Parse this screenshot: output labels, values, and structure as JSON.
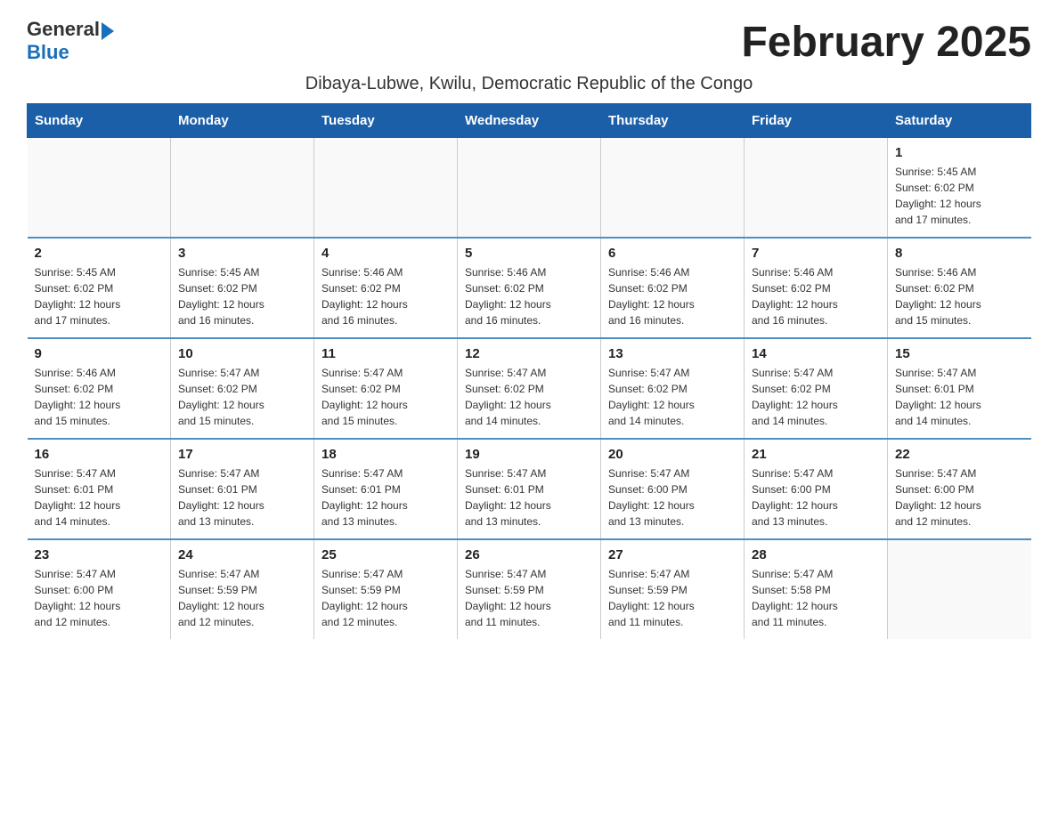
{
  "header": {
    "logo_general": "General",
    "logo_blue": "Blue",
    "month_title": "February 2025",
    "location": "Dibaya-Lubwe, Kwilu, Democratic Republic of the Congo"
  },
  "days_of_week": [
    "Sunday",
    "Monday",
    "Tuesday",
    "Wednesday",
    "Thursday",
    "Friday",
    "Saturday"
  ],
  "weeks": [
    {
      "days": [
        {
          "number": "",
          "info": "",
          "empty": true
        },
        {
          "number": "",
          "info": "",
          "empty": true
        },
        {
          "number": "",
          "info": "",
          "empty": true
        },
        {
          "number": "",
          "info": "",
          "empty": true
        },
        {
          "number": "",
          "info": "",
          "empty": true
        },
        {
          "number": "",
          "info": "",
          "empty": true
        },
        {
          "number": "1",
          "info": "Sunrise: 5:45 AM\nSunset: 6:02 PM\nDaylight: 12 hours\nand 17 minutes.",
          "empty": false
        }
      ]
    },
    {
      "days": [
        {
          "number": "2",
          "info": "Sunrise: 5:45 AM\nSunset: 6:02 PM\nDaylight: 12 hours\nand 17 minutes.",
          "empty": false
        },
        {
          "number": "3",
          "info": "Sunrise: 5:45 AM\nSunset: 6:02 PM\nDaylight: 12 hours\nand 16 minutes.",
          "empty": false
        },
        {
          "number": "4",
          "info": "Sunrise: 5:46 AM\nSunset: 6:02 PM\nDaylight: 12 hours\nand 16 minutes.",
          "empty": false
        },
        {
          "number": "5",
          "info": "Sunrise: 5:46 AM\nSunset: 6:02 PM\nDaylight: 12 hours\nand 16 minutes.",
          "empty": false
        },
        {
          "number": "6",
          "info": "Sunrise: 5:46 AM\nSunset: 6:02 PM\nDaylight: 12 hours\nand 16 minutes.",
          "empty": false
        },
        {
          "number": "7",
          "info": "Sunrise: 5:46 AM\nSunset: 6:02 PM\nDaylight: 12 hours\nand 16 minutes.",
          "empty": false
        },
        {
          "number": "8",
          "info": "Sunrise: 5:46 AM\nSunset: 6:02 PM\nDaylight: 12 hours\nand 15 minutes.",
          "empty": false
        }
      ]
    },
    {
      "days": [
        {
          "number": "9",
          "info": "Sunrise: 5:46 AM\nSunset: 6:02 PM\nDaylight: 12 hours\nand 15 minutes.",
          "empty": false
        },
        {
          "number": "10",
          "info": "Sunrise: 5:47 AM\nSunset: 6:02 PM\nDaylight: 12 hours\nand 15 minutes.",
          "empty": false
        },
        {
          "number": "11",
          "info": "Sunrise: 5:47 AM\nSunset: 6:02 PM\nDaylight: 12 hours\nand 15 minutes.",
          "empty": false
        },
        {
          "number": "12",
          "info": "Sunrise: 5:47 AM\nSunset: 6:02 PM\nDaylight: 12 hours\nand 14 minutes.",
          "empty": false
        },
        {
          "number": "13",
          "info": "Sunrise: 5:47 AM\nSunset: 6:02 PM\nDaylight: 12 hours\nand 14 minutes.",
          "empty": false
        },
        {
          "number": "14",
          "info": "Sunrise: 5:47 AM\nSunset: 6:02 PM\nDaylight: 12 hours\nand 14 minutes.",
          "empty": false
        },
        {
          "number": "15",
          "info": "Sunrise: 5:47 AM\nSunset: 6:01 PM\nDaylight: 12 hours\nand 14 minutes.",
          "empty": false
        }
      ]
    },
    {
      "days": [
        {
          "number": "16",
          "info": "Sunrise: 5:47 AM\nSunset: 6:01 PM\nDaylight: 12 hours\nand 14 minutes.",
          "empty": false
        },
        {
          "number": "17",
          "info": "Sunrise: 5:47 AM\nSunset: 6:01 PM\nDaylight: 12 hours\nand 13 minutes.",
          "empty": false
        },
        {
          "number": "18",
          "info": "Sunrise: 5:47 AM\nSunset: 6:01 PM\nDaylight: 12 hours\nand 13 minutes.",
          "empty": false
        },
        {
          "number": "19",
          "info": "Sunrise: 5:47 AM\nSunset: 6:01 PM\nDaylight: 12 hours\nand 13 minutes.",
          "empty": false
        },
        {
          "number": "20",
          "info": "Sunrise: 5:47 AM\nSunset: 6:00 PM\nDaylight: 12 hours\nand 13 minutes.",
          "empty": false
        },
        {
          "number": "21",
          "info": "Sunrise: 5:47 AM\nSunset: 6:00 PM\nDaylight: 12 hours\nand 13 minutes.",
          "empty": false
        },
        {
          "number": "22",
          "info": "Sunrise: 5:47 AM\nSunset: 6:00 PM\nDaylight: 12 hours\nand 12 minutes.",
          "empty": false
        }
      ]
    },
    {
      "days": [
        {
          "number": "23",
          "info": "Sunrise: 5:47 AM\nSunset: 6:00 PM\nDaylight: 12 hours\nand 12 minutes.",
          "empty": false
        },
        {
          "number": "24",
          "info": "Sunrise: 5:47 AM\nSunset: 5:59 PM\nDaylight: 12 hours\nand 12 minutes.",
          "empty": false
        },
        {
          "number": "25",
          "info": "Sunrise: 5:47 AM\nSunset: 5:59 PM\nDaylight: 12 hours\nand 12 minutes.",
          "empty": false
        },
        {
          "number": "26",
          "info": "Sunrise: 5:47 AM\nSunset: 5:59 PM\nDaylight: 12 hours\nand 11 minutes.",
          "empty": false
        },
        {
          "number": "27",
          "info": "Sunrise: 5:47 AM\nSunset: 5:59 PM\nDaylight: 12 hours\nand 11 minutes.",
          "empty": false
        },
        {
          "number": "28",
          "info": "Sunrise: 5:47 AM\nSunset: 5:58 PM\nDaylight: 12 hours\nand 11 minutes.",
          "empty": false
        },
        {
          "number": "",
          "info": "",
          "empty": true
        }
      ]
    }
  ]
}
